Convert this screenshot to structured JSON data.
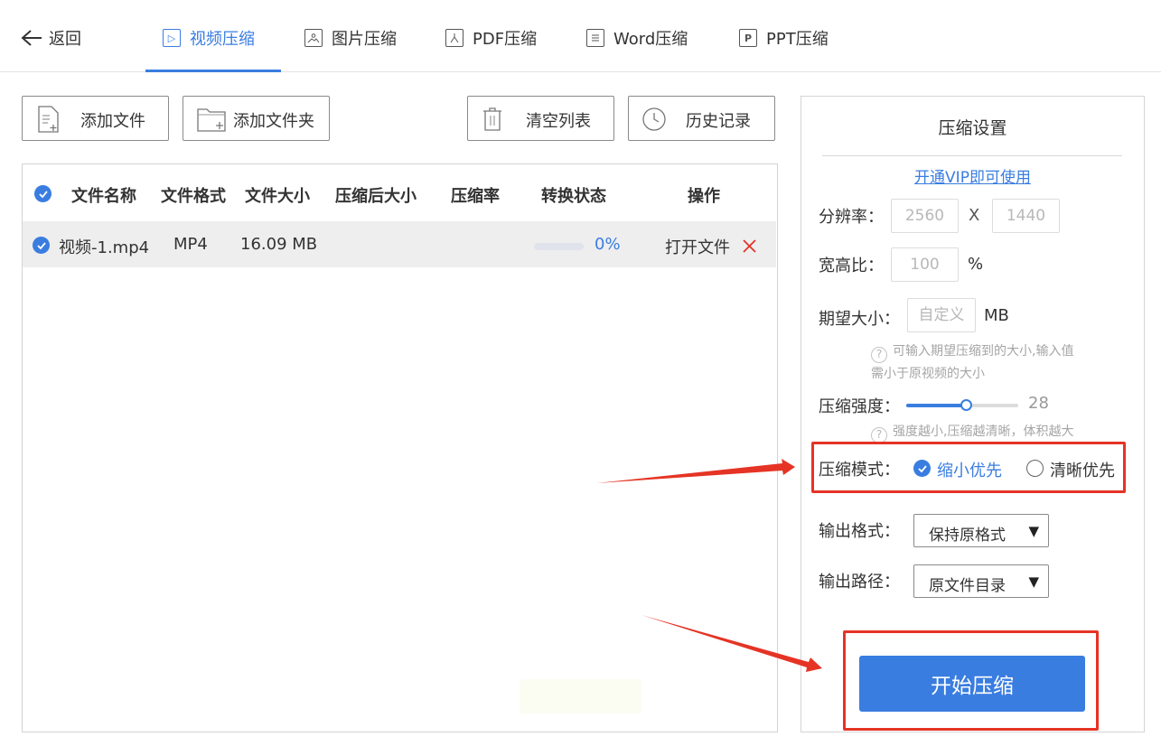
{
  "nav": {
    "back_label": "返回",
    "tabs": [
      {
        "label": "视频压缩",
        "icon": "play-icon",
        "active": true
      },
      {
        "label": "图片压缩",
        "icon": "image-icon",
        "active": false
      },
      {
        "label": "PDF压缩",
        "icon": "pdf-icon",
        "active": false
      },
      {
        "label": "Word压缩",
        "icon": "word-icon",
        "active": false
      },
      {
        "label": "PPT压缩",
        "icon": "ppt-icon",
        "active": false
      }
    ],
    "accent_color": "#3a7de0"
  },
  "toolbar": {
    "add_file": "添加文件",
    "add_folder": "添加文件夹",
    "clear_list": "清空列表",
    "history": "历史记录"
  },
  "table": {
    "columns": [
      "文件名称",
      "文件格式",
      "文件大小",
      "压缩后大小",
      "压缩率",
      "转换状态",
      "操作"
    ],
    "rows": [
      {
        "checked": true,
        "name": "视频-1.mp4",
        "format": "MP4",
        "size": "16.09 MB",
        "compressed_size": "",
        "ratio": "",
        "progress_text": "0%",
        "progress_value": 0,
        "action_open": "打开文件",
        "delete_icon": "close-icon"
      }
    ]
  },
  "settings": {
    "title": "压缩设置",
    "vip_link": "开通VIP即可使用",
    "resolution_label": "分辨率：",
    "resolution_width_placeholder": "2560",
    "resolution_x": "X",
    "resolution_height_placeholder": "1440",
    "aspect_label": "宽高比：",
    "aspect_placeholder": "100",
    "aspect_unit": "%",
    "target_size_label": "期望大小：",
    "target_size_placeholder": "自定义",
    "target_size_unit": "MB",
    "target_hint_line1": "可输入期望压缩到的大小,输入值",
    "target_hint_line2": "需小于原视频的大小",
    "strength_label": "压缩强度：",
    "strength_value": "28",
    "strength_fraction": 0.53,
    "strength_hint": "强度越小,压缩越清晰，体积越大",
    "mode_label": "压缩模式：",
    "mode_options": [
      "缩小优先",
      "清晰优先"
    ],
    "mode_selected": "缩小优先",
    "output_format_label": "输出格式：",
    "output_format_value": "保持原格式",
    "output_path_label": "输出路径：",
    "output_path_value": "原文件目录",
    "start_button": "开始压缩"
  },
  "annotation_color": "#e53425"
}
